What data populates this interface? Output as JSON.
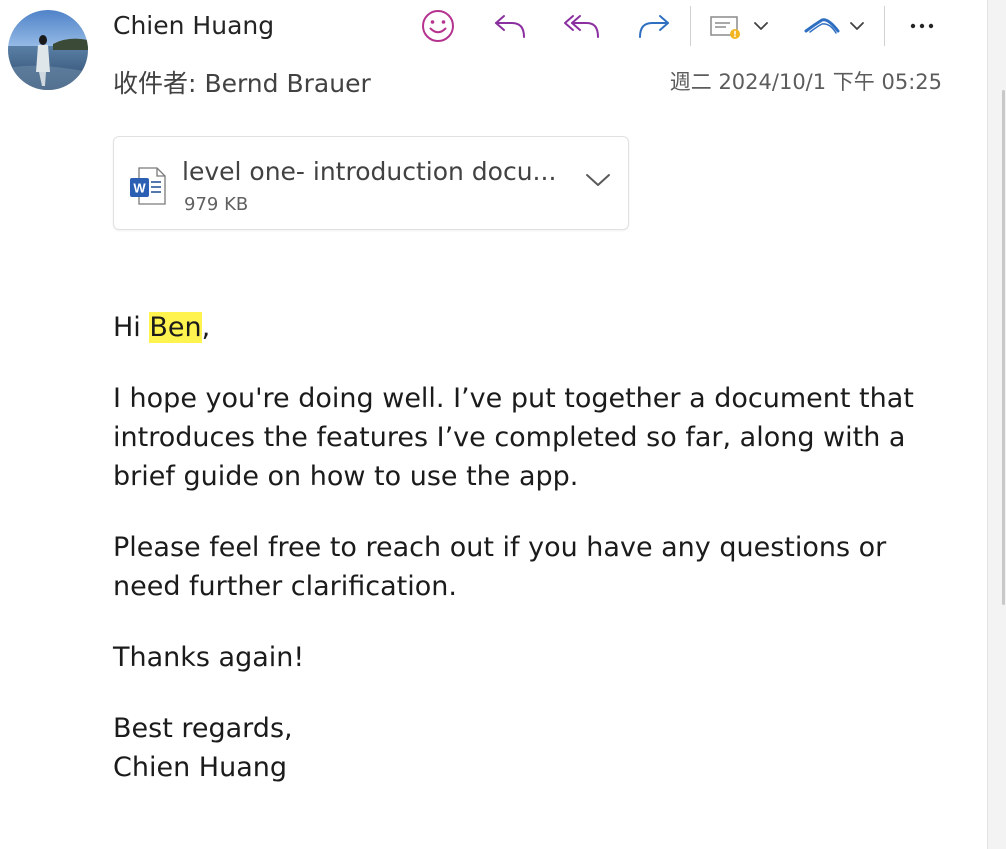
{
  "header": {
    "sender_name": "Chien Huang",
    "recipient_label": "收件者:",
    "recipient_name": "Bernd Brauer",
    "datetime": "週二 2024/10/1 下午 05:25"
  },
  "toolbar": {
    "icons": [
      "smiley-icon",
      "reply-icon",
      "reply-all-icon",
      "forward-icon",
      "flag-envelope-icon",
      "signature-icon",
      "more-icon"
    ],
    "accent_color": "#8b2fa0",
    "blue_color": "#2f6fc2"
  },
  "attachment": {
    "name": "level one- introduction docu...",
    "size": "979 KB",
    "icon": "word-doc-icon"
  },
  "message": {
    "greeting_prefix": "Hi ",
    "greeting_name": "Ben",
    "greeting_suffix": ",",
    "paragraph1": "I hope you're doing well. I’ve put together a document that introduces the features I’ve completed so far, along with a brief guide on how to use the app.",
    "paragraph2": "Please feel free to reach out if you have any questions or need further clarification.",
    "paragraph3": "Thanks again!",
    "closing": "Best regards,",
    "signature": "Chien Huang"
  }
}
